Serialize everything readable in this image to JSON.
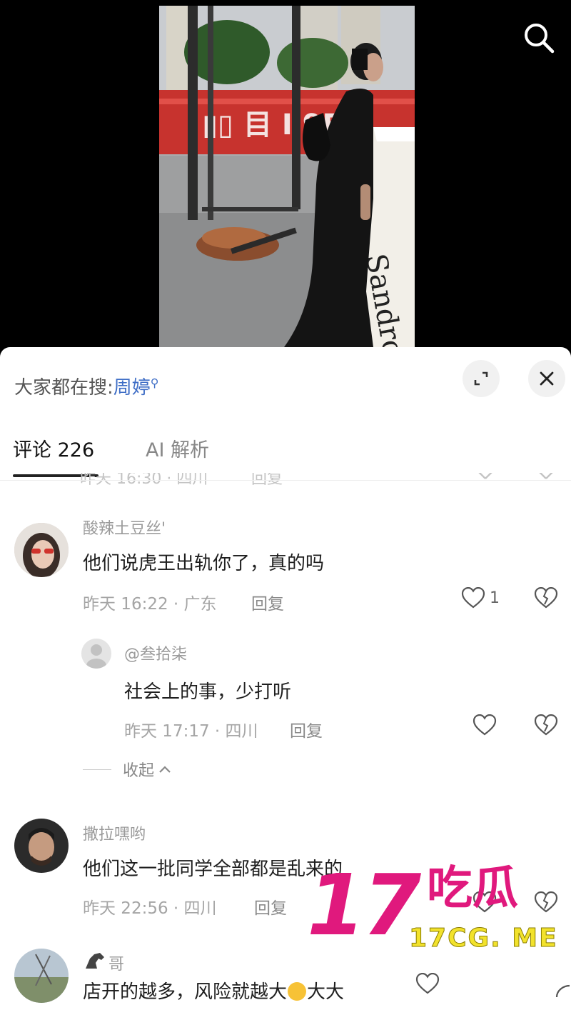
{
  "hot_search": {
    "prefix": "大家都在搜:",
    "term": "周婷"
  },
  "tabs": [
    {
      "label": "评论 226"
    },
    {
      "label": "AI 解析"
    }
  ],
  "truncated_row": {
    "meta": "昨天 16:30 · 四川",
    "reply": "回复"
  },
  "comments": [
    {
      "username": "酸辣土豆丝'",
      "text": "他们说虎王出轨你了，真的吗",
      "meta": "昨天 16:22 · 广东",
      "reply_label": "回复",
      "likes": "1"
    },
    {
      "username": "@叁拾柒",
      "text": "社会上的事，少打听",
      "meta": "昨天 17:17 · 四川",
      "reply_label": "回复",
      "likes": ""
    },
    {
      "username": "撒拉嘿哟",
      "text": "他们这一批同学全部都是乱来的",
      "meta": "昨天 22:56 · 四川",
      "reply_label": "回复",
      "likes": ""
    },
    {
      "username": "哥",
      "text": "店开的越多，风险就越大",
      "text_suffix": "大大",
      "meta": "",
      "reply_label": "",
      "likes": ""
    }
  ],
  "collapse_label": "收起",
  "watermark": {
    "number": "17",
    "chinese": "吃瓜",
    "url": "17CG. ME"
  },
  "colors": {
    "link_blue": "#3f6ec6",
    "watermark_pink": "#e0197d",
    "watermark_yellow": "#f2e22c"
  }
}
